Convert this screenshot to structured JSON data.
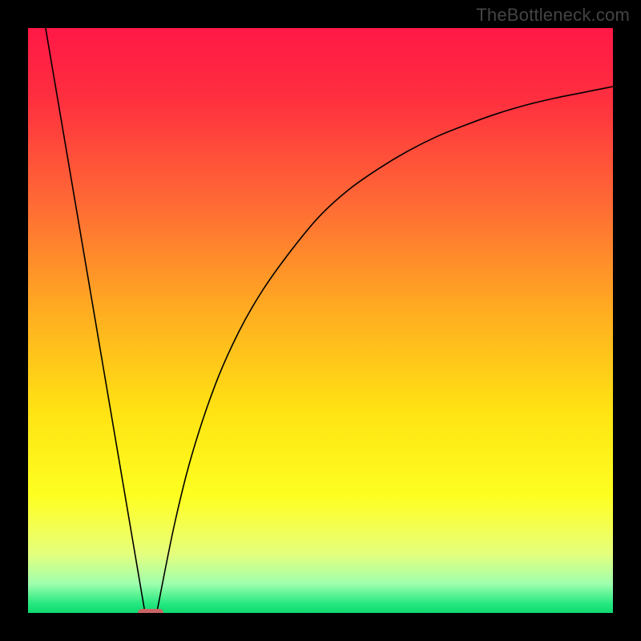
{
  "watermark": "TheBottleneck.com",
  "chart_data": {
    "type": "line",
    "title": "",
    "xlabel": "",
    "ylabel": "",
    "xlim": [
      0,
      100
    ],
    "ylim": [
      0,
      100
    ],
    "grid": false,
    "legend": false,
    "gradient_stops": [
      {
        "pos": 0.0,
        "color": "#ff1846"
      },
      {
        "pos": 0.12,
        "color": "#ff2f3f"
      },
      {
        "pos": 0.3,
        "color": "#ff6a35"
      },
      {
        "pos": 0.5,
        "color": "#ffb21f"
      },
      {
        "pos": 0.66,
        "color": "#ffe413"
      },
      {
        "pos": 0.8,
        "color": "#fdff21"
      },
      {
        "pos": 0.85,
        "color": "#f4ff4e"
      },
      {
        "pos": 0.9,
        "color": "#e4ff7e"
      },
      {
        "pos": 0.95,
        "color": "#9fffae"
      },
      {
        "pos": 0.985,
        "color": "#23e87f"
      },
      {
        "pos": 1.0,
        "color": "#10d870"
      }
    ],
    "series": [
      {
        "name": "left-line",
        "type": "line",
        "x": [
          3,
          20
        ],
        "values": [
          100,
          0
        ]
      },
      {
        "name": "right-curve",
        "type": "line",
        "x": [
          22,
          25,
          28,
          32,
          36,
          40,
          45,
          50,
          55,
          60,
          65,
          70,
          75,
          80,
          85,
          90,
          95,
          100
        ],
        "values": [
          0,
          15,
          27,
          39,
          48,
          55,
          62,
          68,
          72.5,
          76,
          79,
          81.5,
          83.5,
          85.3,
          86.8,
          88,
          89,
          90
        ]
      }
    ],
    "marker": {
      "x_center": 21,
      "width_pct": 4.4,
      "color": "#c96464"
    }
  }
}
